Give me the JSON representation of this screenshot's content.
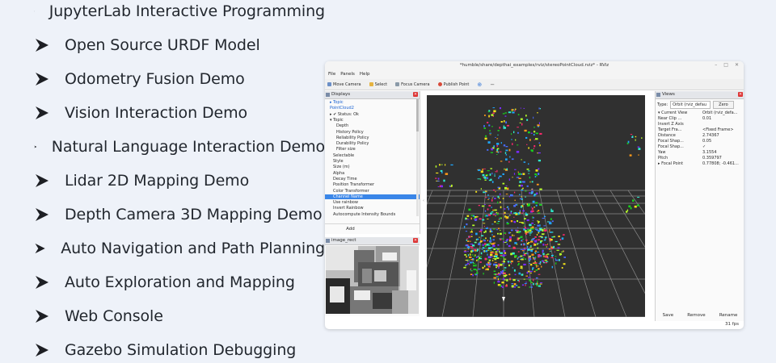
{
  "features": [
    "JupyterLab Interactive Programming",
    "Open Source URDF Model",
    "Odometry Fusion Demo",
    "Vision Interaction Demo",
    "Natural Language Interaction Demo",
    "Lidar 2D Mapping Demo",
    "Depth Camera 3D Mapping Demo",
    "Auto Navigation and Path Planning",
    "Auto Exploration and Mapping",
    "Web Console",
    "Gazebo Simulation Debugging"
  ],
  "rviz": {
    "window_title": "*humble/share/depthai_examples/rviz/stereoPointCloud.rviz* - RViz",
    "menu": [
      "File",
      "Panels",
      "Help"
    ],
    "toolbar": [
      "Move Camera",
      "Select",
      "Focus Camera",
      "Publish Point"
    ],
    "displays": {
      "title": "Displays",
      "rows": [
        {
          "indent": 1,
          "text": "▸  Topic",
          "style": "blue"
        },
        {
          "indent": 1,
          "text": "PointCloud2",
          "style": "blue"
        },
        {
          "indent": 1,
          "text": "▸  ✔  Status: Ok",
          "style": ""
        },
        {
          "indent": 1,
          "text": "▾  Topic",
          "style": ""
        },
        {
          "indent": 3,
          "text": "Depth",
          "style": ""
        },
        {
          "indent": 3,
          "text": "History Policy",
          "style": ""
        },
        {
          "indent": 3,
          "text": "Reliability Policy",
          "style": ""
        },
        {
          "indent": 3,
          "text": "Durability Policy",
          "style": ""
        },
        {
          "indent": 3,
          "text": "Filter size",
          "style": ""
        },
        {
          "indent": 2,
          "text": "Selectable",
          "style": ""
        },
        {
          "indent": 2,
          "text": "Style",
          "style": ""
        },
        {
          "indent": 2,
          "text": "Size (m)",
          "style": ""
        },
        {
          "indent": 2,
          "text": "Alpha",
          "style": ""
        },
        {
          "indent": 2,
          "text": "Decay Time",
          "style": ""
        },
        {
          "indent": 2,
          "text": "Position Transformer",
          "style": ""
        },
        {
          "indent": 2,
          "text": "Color Transformer",
          "style": ""
        },
        {
          "indent": 2,
          "text": "Channel Name",
          "style": "sel"
        },
        {
          "indent": 2,
          "text": "Use rainbow",
          "style": ""
        },
        {
          "indent": 2,
          "text": "Invert Rainbow",
          "style": ""
        },
        {
          "indent": 2,
          "text": "Autocompute Intensity Bounds",
          "style": ""
        }
      ],
      "add_button": "Add"
    },
    "image_panel": {
      "title": "image_rect"
    },
    "views": {
      "title": "Views",
      "type_label": "Type:",
      "type_value": "Orbit (rviz_defau",
      "zero_button": "Zero",
      "rows": [
        {
          "key": "▾  Current View",
          "value": "Orbit (rviz_defa..."
        },
        {
          "key": "   Near Clip ...",
          "value": "0.01"
        },
        {
          "key": "   Invert Z Axis",
          "value": ""
        },
        {
          "key": "   Target Fra...",
          "value": "<Fixed Frame>"
        },
        {
          "key": "   Distance",
          "value": "2.74367"
        },
        {
          "key": "   Focal Shap...",
          "value": "0.05"
        },
        {
          "key": "   Focal Shap...",
          "value": "✓"
        },
        {
          "key": "   Yaw",
          "value": "3.1554"
        },
        {
          "key": "   Pitch",
          "value": "0.359797"
        },
        {
          "key": "▸  Focal Point",
          "value": "0.77808; -0.461..."
        }
      ],
      "buttons": [
        "Save",
        "Remove",
        "Rename"
      ],
      "fps": "31 fps"
    }
  }
}
